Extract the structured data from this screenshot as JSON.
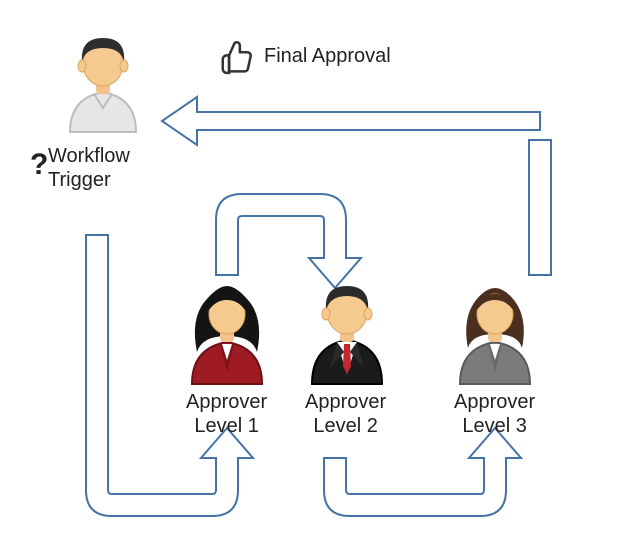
{
  "diagram": {
    "final_approval_label": "Final Approval",
    "trigger_label": "Workflow\nTrigger",
    "question_mark": "?",
    "approver1_label": "Approver\nLevel 1",
    "approver2_label": "Approver\nLevel 2",
    "approver3_label": "Approver\nLevel 3",
    "colors": {
      "arrow_stroke": "#4573A7",
      "thumb_stroke": "#333333"
    },
    "nodes": [
      {
        "id": "trigger",
        "role": "Workflow Trigger"
      },
      {
        "id": "approver1",
        "role": "Approver Level 1"
      },
      {
        "id": "approver2",
        "role": "Approver Level 2"
      },
      {
        "id": "approver3",
        "role": "Approver Level 3"
      }
    ],
    "flow_edges": [
      {
        "from": "trigger",
        "to": "approver1"
      },
      {
        "from": "approver1",
        "to": "approver2"
      },
      {
        "from": "approver2",
        "to": "approver3"
      },
      {
        "from": "approver3",
        "to": "trigger",
        "label": "Final Approval"
      }
    ]
  }
}
